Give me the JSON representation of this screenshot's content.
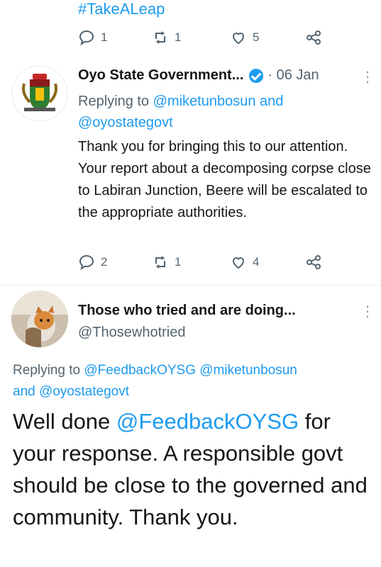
{
  "prev_tweet": {
    "hashtag": "#TakeALeap",
    "replies": "1",
    "retweets": "1",
    "likes": "5"
  },
  "tweet1": {
    "name": "Oyo State Government...",
    "date": "· 06 Jan",
    "replying_prefix": "Replying to ",
    "mention_a": "@miketunbosun",
    "mention_joiner": " and",
    "mention_b": "@oyostategovt",
    "body": "Thank you for bringing this to our attention. Your report about a decomposing corpse close to Labiran Junction, Beere will be escalated to the appropriate authorities.",
    "replies": "2",
    "retweets": "1",
    "likes": "4"
  },
  "tweet2": {
    "name": "Those who tried and are doing...",
    "handle": "@Thosewhotried",
    "replying_prefix": "Replying to ",
    "mention_a": "@FeedbackOYSG",
    "mention_b": "@miketunbosun",
    "mention_joiner": "and ",
    "mention_c": "@oyostategovt",
    "body_prefix": "Well done ",
    "body_mention": "@FeedbackOYSG",
    "body_rest": " for your response. A responsible govt should be close to the governed and community. Thank you."
  },
  "icons": {
    "reply": "reply-icon",
    "retweet": "retweet-icon",
    "like": "heart-icon",
    "share": "share-icon",
    "more": "more-options-icon",
    "verified": "verified-badge-icon"
  },
  "colors": {
    "accent": "#1d9bf0",
    "muted": "#536471",
    "text": "#14171a"
  }
}
